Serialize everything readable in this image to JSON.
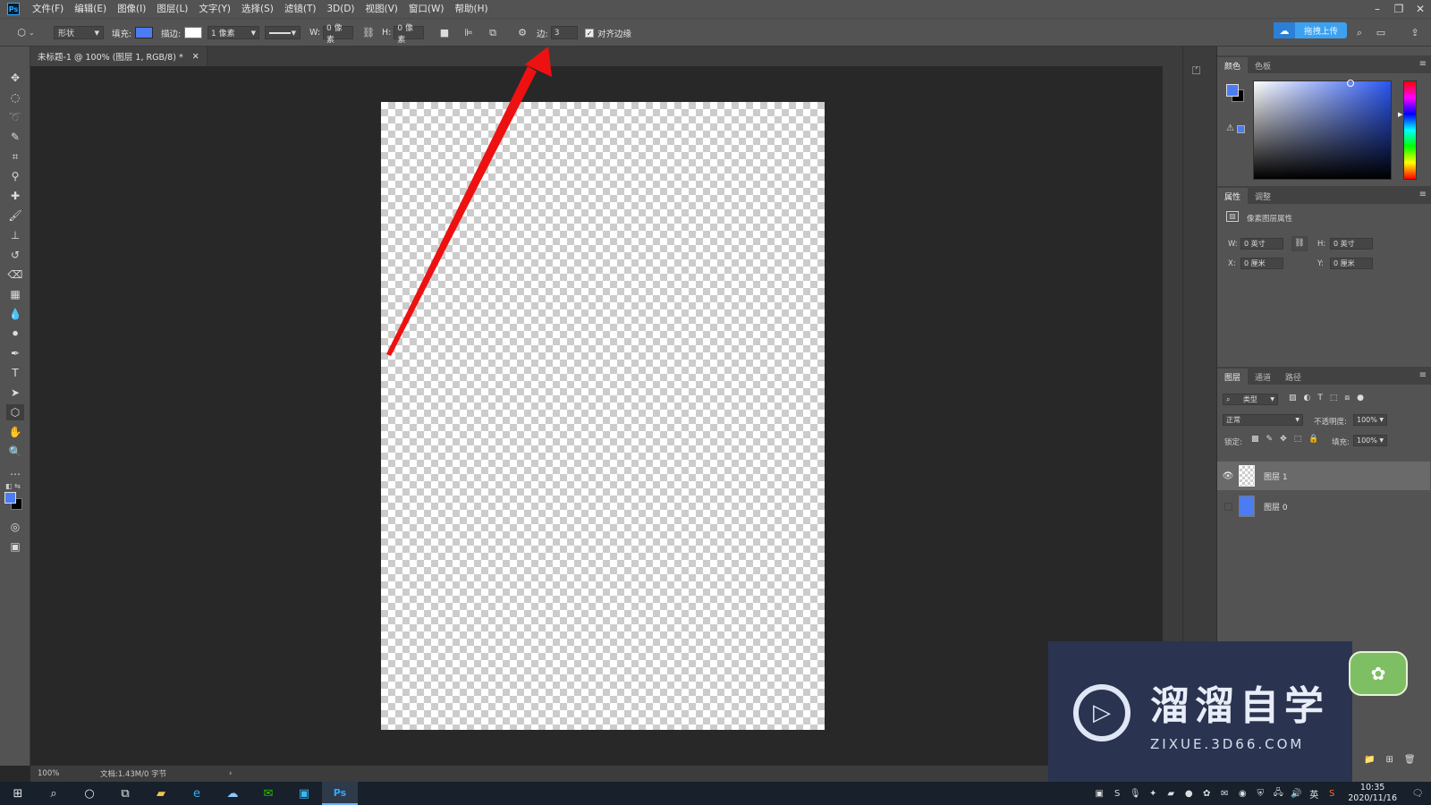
{
  "menubar": {
    "items": [
      "文件(F)",
      "编辑(E)",
      "图像(I)",
      "图层(L)",
      "文字(Y)",
      "选择(S)",
      "滤镜(T)",
      "3D(D)",
      "视图(V)",
      "窗口(W)",
      "帮助(H)"
    ]
  },
  "options": {
    "mode": "形状",
    "fill_label": "填充:",
    "fill_color": "#4c7cf3",
    "stroke_label": "描边:",
    "stroke_width": "1 像素",
    "w_label": "W:",
    "w_value": "0 像素",
    "h_label": "H:",
    "h_value": "0 像素",
    "sides_label": "边:",
    "sides_value": "3",
    "align_edges": "对齐边缘",
    "upload_button": "拖拽上传"
  },
  "document": {
    "tab_title": "未标题-1 @ 100% (图层 1, RGB/8) *",
    "zoom": "100%",
    "doc_info": "文档:1.43M/0 字节"
  },
  "color_panel": {
    "tabs": [
      "颜色",
      "色板"
    ],
    "fg_color": "#4c7cf3",
    "bg_color": "#000000"
  },
  "properties_panel": {
    "tabs": [
      "属性",
      "调整"
    ],
    "header": "像素图层属性",
    "w_label": "W:",
    "w_value": "0 英寸",
    "h_label": "H:",
    "h_value": "0 英寸",
    "x_label": "X:",
    "x_value": "0 厘米",
    "y_label": "Y:",
    "y_value": "0 厘米"
  },
  "layers_panel": {
    "tabs": [
      "图层",
      "通道",
      "路径"
    ],
    "filter": "类型",
    "blend_mode": "正常",
    "opacity_label": "不透明度:",
    "opacity": "100%",
    "lock_label": "锁定:",
    "fill_label": "填充:",
    "fill": "100%",
    "layers": [
      {
        "name": "图层 1",
        "visible": true,
        "selected": true
      },
      {
        "name": "图层 0",
        "visible": false,
        "selected": false
      }
    ]
  },
  "watermark": {
    "title": "溜溜自学",
    "url": "ZIXUE.3D66.COM"
  },
  "taskbar": {
    "time": "10:35",
    "date": "2020/11/16",
    "ime": "英"
  },
  "annotation_color": "#ee1111"
}
